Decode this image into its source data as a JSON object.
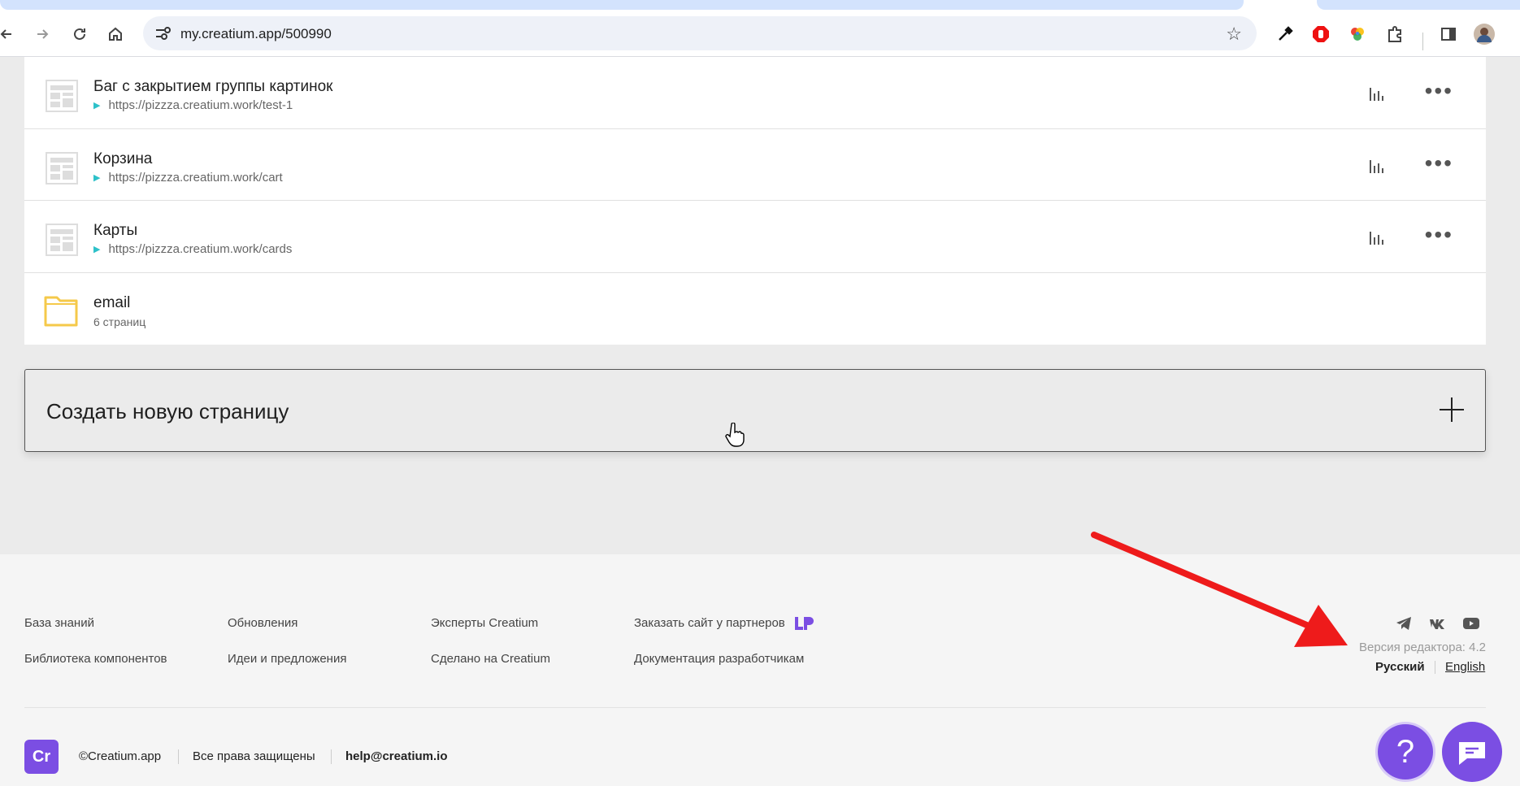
{
  "browser": {
    "url": "my.creatium.app/500990",
    "back_icon": "arrow-left-icon",
    "forward_icon": "arrow-right-icon",
    "reload_icon": "reload-icon",
    "home_icon": "home-icon"
  },
  "pages": [
    {
      "title": "Баг с закрытием группы картинок",
      "url": "https://pizzza.creatium.work/test-1"
    },
    {
      "title": "Корзина",
      "url": "https://pizzza.creatium.work/cart"
    },
    {
      "title": "Карты",
      "url": "https://pizzza.creatium.work/cards"
    }
  ],
  "folder": {
    "title": "email",
    "count": "6 страниц"
  },
  "create": {
    "label": "Создать новую страницу"
  },
  "footer": {
    "col1": [
      "База знаний",
      "Библиотека компонентов"
    ],
    "col2": [
      "Обновления",
      "Идеи и предложения"
    ],
    "col3": [
      "Эксперты Creatium",
      "Сделано на Creatium"
    ],
    "col4": [
      "Заказать сайт у партнеров",
      "Документация разработчикам"
    ],
    "version": "Версия редактора: 4.2",
    "lang_ru": "Русский",
    "lang_en": "English",
    "copyright": "©Creatium.app",
    "rights": "Все права защищены",
    "email": "help@creatium.io",
    "logo_text": "Cr"
  },
  "colors": {
    "accent": "#7b4ee3",
    "annotation": "#ee1b1b",
    "play": "#2dc1c9",
    "folder": "#f5c94a"
  }
}
